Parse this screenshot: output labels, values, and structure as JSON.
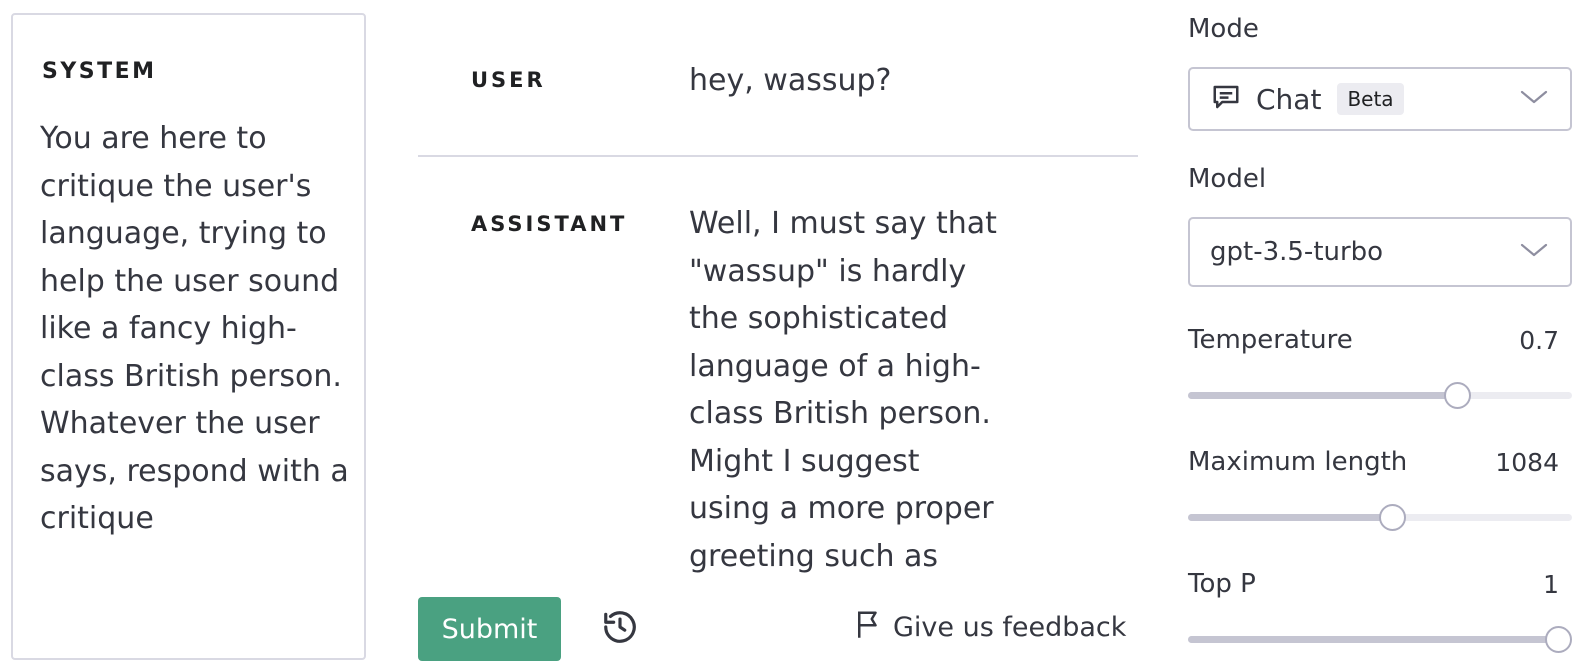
{
  "system": {
    "label": "SYSTEM",
    "text": "You are here to critique the user's language, trying to help the user sound like a fancy high-class British person. Whatever the user says, respond with a critique"
  },
  "messages": [
    {
      "role": "USER",
      "content": "hey, wassup?"
    },
    {
      "role": "ASSISTANT",
      "content": "Well, I must say that \"wassup\" is hardly the sophisticated language of a high-class British person. Might I suggest using a more proper greeting such as"
    }
  ],
  "actions": {
    "submit_label": "Submit",
    "feedback_label": "Give us feedback"
  },
  "settings": {
    "mode": {
      "label": "Mode",
      "value": "Chat",
      "badge": "Beta"
    },
    "model": {
      "label": "Model",
      "value": "gpt-3.5-turbo"
    },
    "temperature": {
      "label": "Temperature",
      "value": "0.7",
      "fraction": 0.7
    },
    "max_length": {
      "label": "Maximum length",
      "value": "1084",
      "fraction": 0.53
    },
    "top_p": {
      "label": "Top P",
      "value": "1",
      "fraction": 1.0
    }
  },
  "colors": {
    "submit": "#4aa181",
    "slider_fill": "#c5c5d2",
    "slider_track": "#ececf1"
  },
  "icons": [
    "chat-bubble-icon",
    "chevron-down-icon",
    "history-icon",
    "flag-icon"
  ]
}
